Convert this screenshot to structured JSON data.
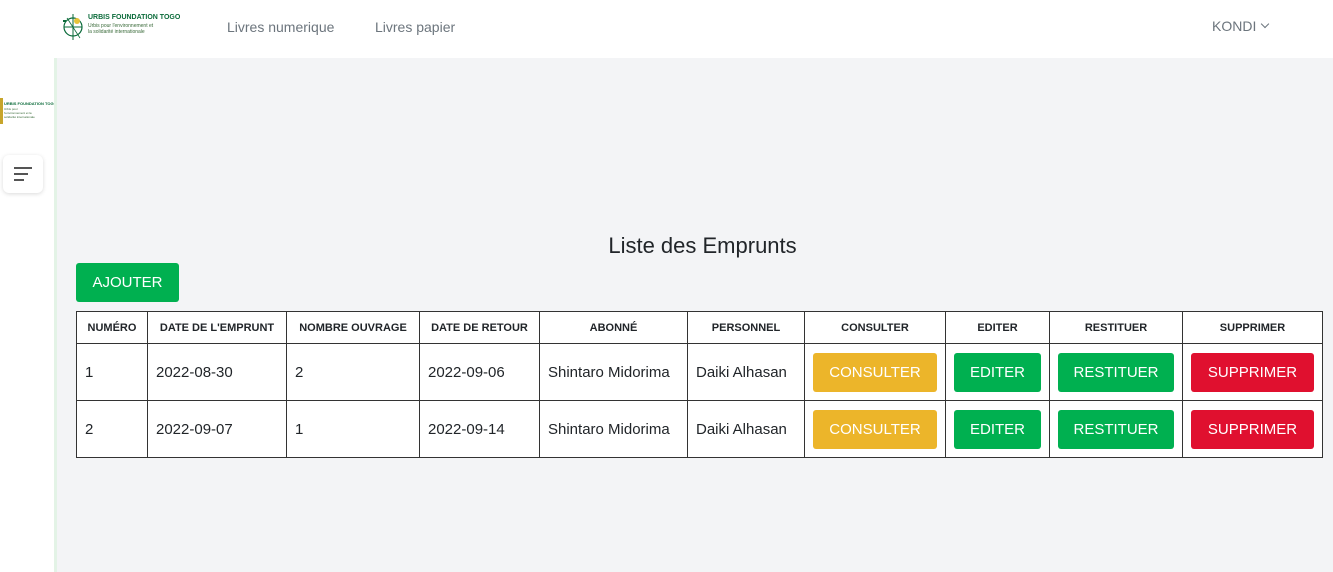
{
  "navbar": {
    "logo_title": "URBIS FOUNDATION TOGO",
    "logo_subtitle": "Urbis pour l'environnement et la solidarité internationale",
    "links": [
      "Livres numerique",
      "Livres papier"
    ],
    "user": "KONDI"
  },
  "sidebar": {
    "logo_title": "URBIS FOUNDATION TOGO",
    "logo_subtitle": "Urbis pour l'environnement et la solidarité internationale"
  },
  "main": {
    "title": "Liste des Emprunts",
    "add_label": "AJOUTER",
    "table": {
      "headers": [
        "NUMÉRO",
        "DATE DE L'EMPRUNT",
        "NOMBRE OUVRAGE",
        "DATE DE RETOUR",
        "ABONNÉ",
        "PERSONNEL",
        "CONSULTER",
        "EDITER",
        "RESTITUER",
        "SUPPRIMER"
      ],
      "rows": [
        {
          "numero": "1",
          "date_emprunt": "2022-08-30",
          "nombre": "2",
          "date_retour": "2022-09-06",
          "abonne": "Shintaro Midorima",
          "personnel": "Daiki Alhasan"
        },
        {
          "numero": "2",
          "date_emprunt": "2022-09-07",
          "nombre": "1",
          "date_retour": "2022-09-14",
          "abonne": "Shintaro Midorima",
          "personnel": "Daiki Alhasan"
        }
      ],
      "action_labels": {
        "consult": "CONSULTER",
        "edit": "EDITER",
        "return": "RESTITUER",
        "delete": "SUPPRIMER"
      }
    }
  },
  "colors": {
    "green": "#00b050",
    "yellow": "#ecb52a",
    "red": "#e0102f",
    "background": "#f3f4f6"
  }
}
